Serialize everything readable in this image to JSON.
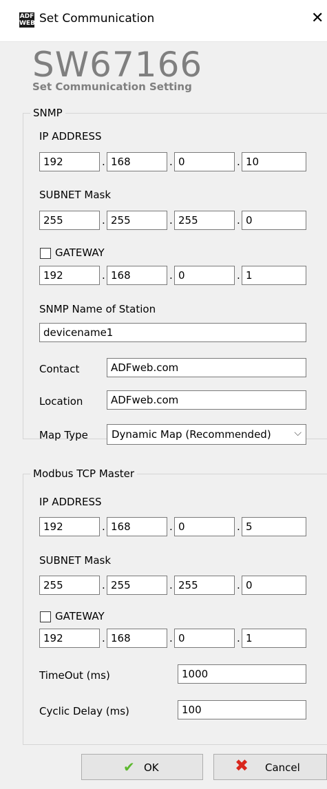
{
  "window": {
    "title": "Set Communication",
    "icon_lines": [
      "ADF",
      "WEB"
    ]
  },
  "header": {
    "brand": "SW67166",
    "subtitle": "Set Communication Setting"
  },
  "snmp": {
    "legend": "SNMP",
    "ip_label": "IP ADDRESS",
    "ip": [
      "192",
      "168",
      "0",
      "10"
    ],
    "subnet_label": "SUBNET Mask",
    "subnet": [
      "255",
      "255",
      "255",
      "0"
    ],
    "gateway_label": "GATEWAY",
    "gateway_checked": false,
    "gateway": [
      "192",
      "168",
      "0",
      "1"
    ],
    "station_label": "SNMP Name of Station",
    "station_value": "devicename1",
    "contact_label": "Contact",
    "contact_value": "ADFweb.com",
    "location_label": "Location",
    "location_value": "ADFweb.com",
    "maptype_label": "Map Type",
    "maptype_value": "Dynamic Map (Recommended)"
  },
  "modbus": {
    "legend": "Modbus TCP Master",
    "ip_label": "IP ADDRESS",
    "ip": [
      "192",
      "168",
      "0",
      "5"
    ],
    "subnet_label": "SUBNET Mask",
    "subnet": [
      "255",
      "255",
      "255",
      "0"
    ],
    "gateway_label": "GATEWAY",
    "gateway_checked": false,
    "gateway": [
      "192",
      "168",
      "0",
      "1"
    ],
    "timeout_label": "TimeOut (ms)",
    "timeout_value": "1000",
    "cyclic_label": "Cyclic Delay (ms)",
    "cyclic_value": "100"
  },
  "buttons": {
    "ok": "OK",
    "cancel": "Cancel"
  },
  "icons": {
    "ok": "check-icon",
    "cancel": "x-icon",
    "close": "close-icon",
    "dropdown": "chevron-down-icon"
  },
  "colors": {
    "brand_gray": "#7f7f7f",
    "check_green": "#5cb82e",
    "cancel_red": "#d9261c"
  }
}
